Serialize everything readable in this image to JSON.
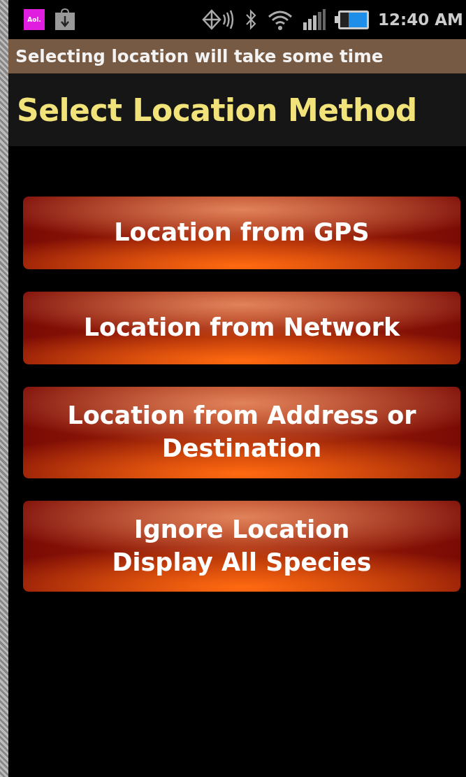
{
  "status_bar": {
    "app_badge": "Aol.",
    "time": "12:40 AM"
  },
  "notice": "Selecting location will take some time",
  "title": "Select Location Method",
  "buttons": [
    {
      "label": "Location from GPS"
    },
    {
      "label": "Location from Network"
    },
    {
      "label": "Location from Address or Destination"
    },
    {
      "label": "Ignore Location\nDisplay All Species"
    }
  ]
}
